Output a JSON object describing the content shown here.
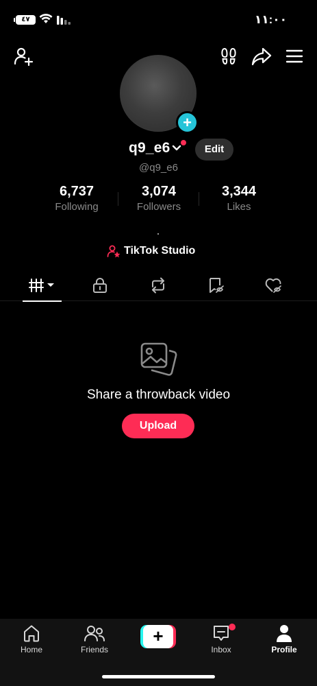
{
  "status_bar": {
    "time": "١١:٠٠",
    "battery": "٤٧"
  },
  "profile": {
    "username": "q9_e6",
    "handle": "@q9_e6",
    "edit_label": "Edit",
    "stats": {
      "following": {
        "value": "6,737",
        "label": "Following"
      },
      "followers": {
        "value": "3,074",
        "label": "Followers"
      },
      "likes": {
        "value": "3,344",
        "label": "Likes"
      }
    },
    "studio_label": "TikTok Studio"
  },
  "tabs": [
    {
      "name": "videos",
      "icon": "grid-icon",
      "active": true
    },
    {
      "name": "private",
      "icon": "lock-icon",
      "active": false
    },
    {
      "name": "reposts",
      "icon": "repost-icon",
      "active": false
    },
    {
      "name": "favorites",
      "icon": "bookmark-icon",
      "active": false
    },
    {
      "name": "liked",
      "icon": "heart-hidden-icon",
      "active": false
    }
  ],
  "empty_state": {
    "message": "Share a throwback video",
    "button_label": "Upload"
  },
  "bottom_nav": {
    "home": "Home",
    "friends": "Friends",
    "inbox": "Inbox",
    "profile": "Profile"
  },
  "colors": {
    "accent": "#fe2c55",
    "cyan": "#25c4d8",
    "background": "#000000"
  }
}
